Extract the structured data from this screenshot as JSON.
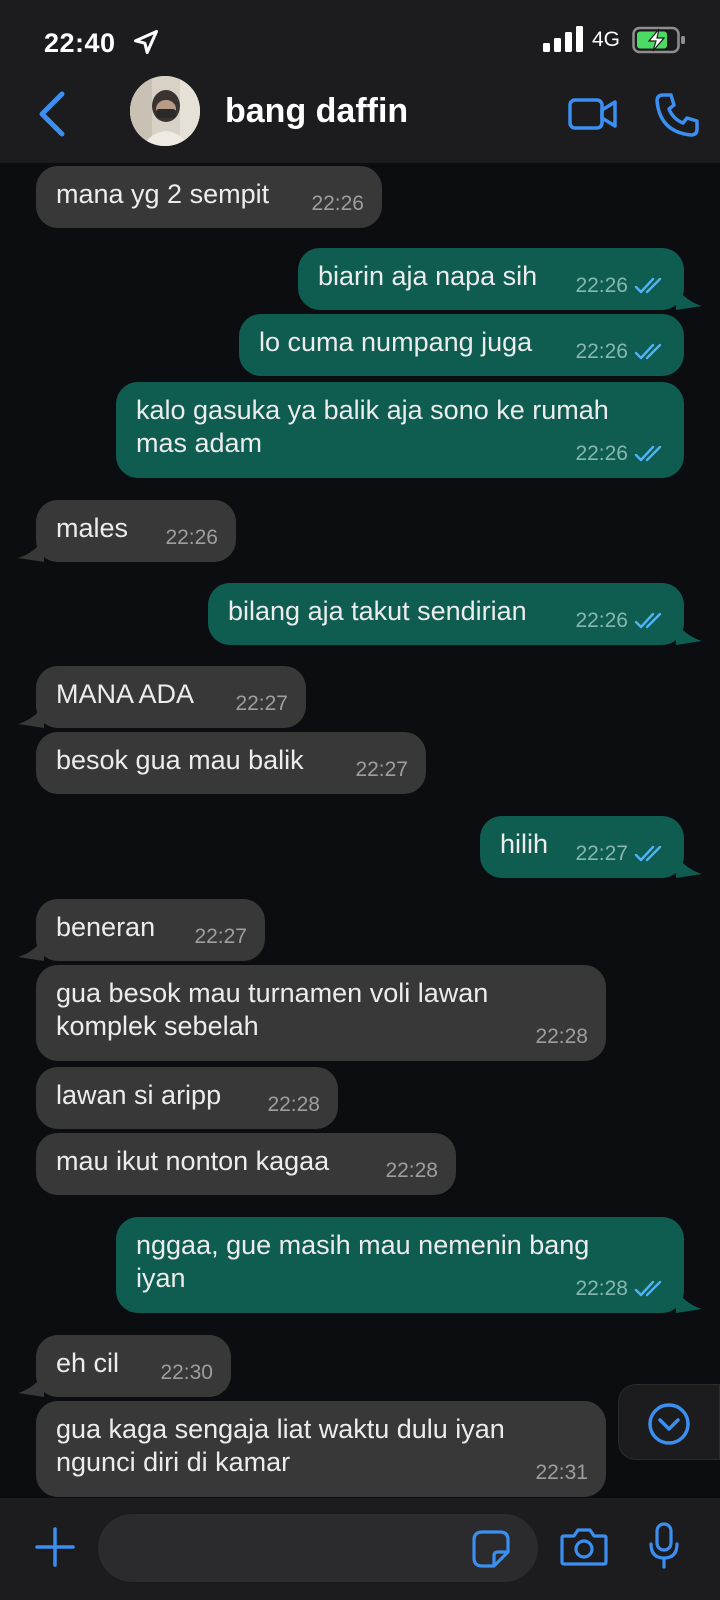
{
  "status_bar": {
    "time": "22:40",
    "network": "4G"
  },
  "header": {
    "contact_name": "bang daffin"
  },
  "messages": [
    {
      "dir": "in",
      "text": "mana yg 2 sempit",
      "time": "22:26",
      "tail": false
    },
    {
      "dir": "out",
      "text": "biarin aja napa sih",
      "time": "22:26",
      "tail": true,
      "read": true
    },
    {
      "dir": "out",
      "text": "lo cuma numpang juga",
      "time": "22:26",
      "tail": false,
      "read": true
    },
    {
      "dir": "out",
      "text": "kalo gasuka ya balik aja sono ke rumah\nmas adam",
      "time": "22:26",
      "tail": false,
      "read": true
    },
    {
      "dir": "in",
      "text": "males",
      "time": "22:26",
      "tail": true
    },
    {
      "dir": "out",
      "text": "bilang aja takut sendirian",
      "time": "22:26",
      "tail": true,
      "read": true
    },
    {
      "dir": "in",
      "text": "MANA ADA",
      "time": "22:27",
      "tail": true
    },
    {
      "dir": "in",
      "text": "besok gua mau balik",
      "time": "22:27",
      "tail": false
    },
    {
      "dir": "out",
      "text": "hilih",
      "time": "22:27",
      "tail": true,
      "read": true
    },
    {
      "dir": "in",
      "text": "beneran",
      "time": "22:27",
      "tail": true
    },
    {
      "dir": "in",
      "text": "gua besok mau turnamen voli lawan\nkomplek sebelah",
      "time": "22:28",
      "tail": false
    },
    {
      "dir": "in",
      "text": "lawan si aripp",
      "time": "22:28",
      "tail": false
    },
    {
      "dir": "in",
      "text": "mau ikut nonton kagaa",
      "time": "22:28",
      "tail": false
    },
    {
      "dir": "out",
      "text": "nggaa, gue masih mau nemenin bang\niyan",
      "time": "22:28",
      "tail": true,
      "read": true
    },
    {
      "dir": "in",
      "text": "eh cil",
      "time": "22:30",
      "tail": true
    },
    {
      "dir": "in",
      "text": "gua kaga sengaja liat waktu dulu iyan\nngunci diri di kamar",
      "time": "22:31",
      "tail": false
    }
  ],
  "composer": {
    "placeholder": ""
  },
  "colors": {
    "accent": "#3a8ff0",
    "incoming": "#383838",
    "outgoing": "#0f5c50",
    "read_ticks": "#4fb3f6"
  }
}
